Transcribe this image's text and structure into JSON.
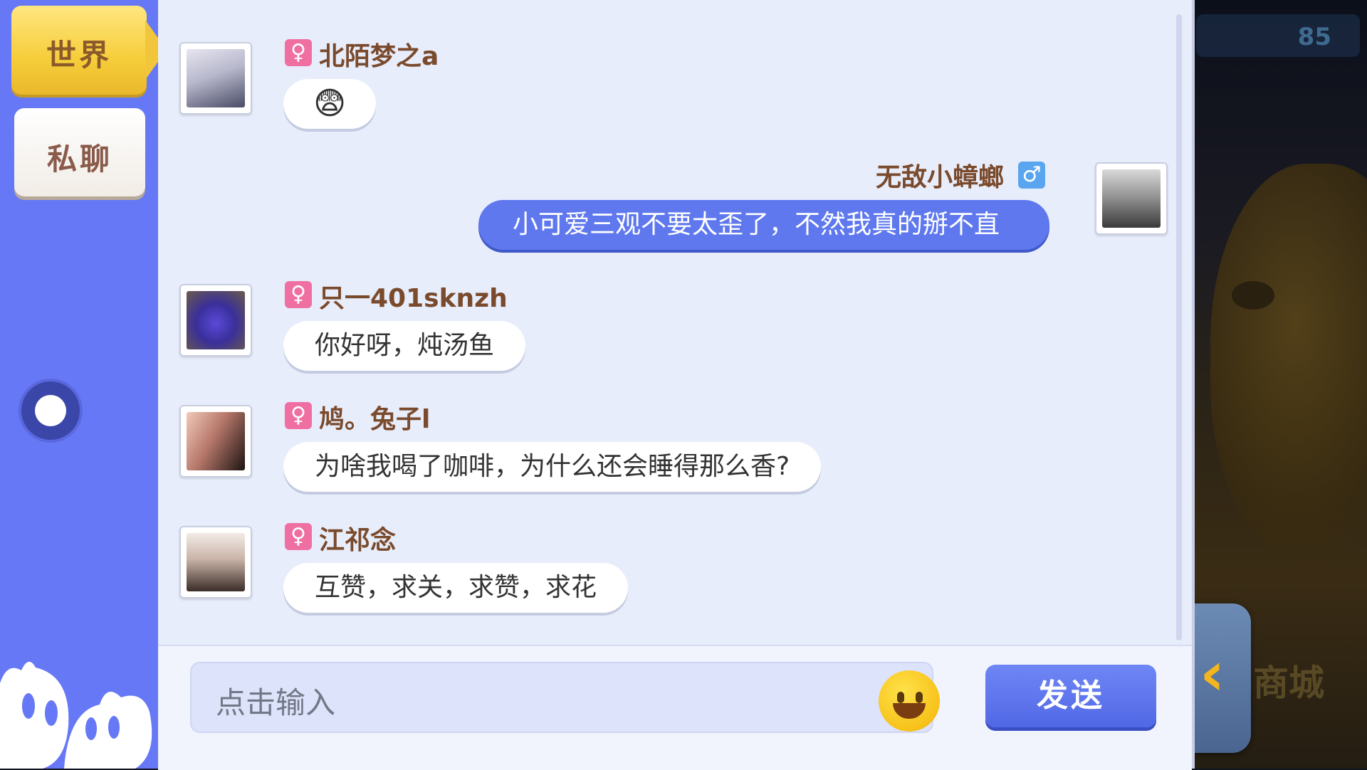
{
  "tabs": {
    "world": "世界",
    "private": "私聊"
  },
  "game_bg": {
    "gem_count": "85",
    "shop_label": "商城"
  },
  "messages": [
    {
      "user": "北陌梦之a",
      "gender": "female",
      "gender_icon": "♀",
      "content": "😨",
      "type": "emoji"
    },
    {
      "user": "无敌小蟑螂",
      "gender": "male",
      "gender_icon": "♂",
      "content": "小可爱三观不要太歪了，不然我真的掰不直",
      "own": true
    },
    {
      "user": "只一401sknzh",
      "gender": "female",
      "gender_icon": "♀",
      "content": "你好呀，炖汤鱼"
    },
    {
      "user": "鸠。兔子l",
      "gender": "female",
      "gender_icon": "♀",
      "content": "为啥我喝了咖啡，为什么还会睡得那么香?"
    },
    {
      "user": "江祁念",
      "gender": "female",
      "gender_icon": "♀",
      "content": "互赞，求关，求赞，求花"
    }
  ],
  "input": {
    "placeholder": "点击输入",
    "send_label": "发送"
  },
  "colors": {
    "sidebar": "#6678f5",
    "panel": "#e8edfb",
    "own_bubble": "#5f78ee",
    "female": "#ef6fa2",
    "male": "#5aa5ef",
    "tab_active": "#f6cd3a"
  }
}
